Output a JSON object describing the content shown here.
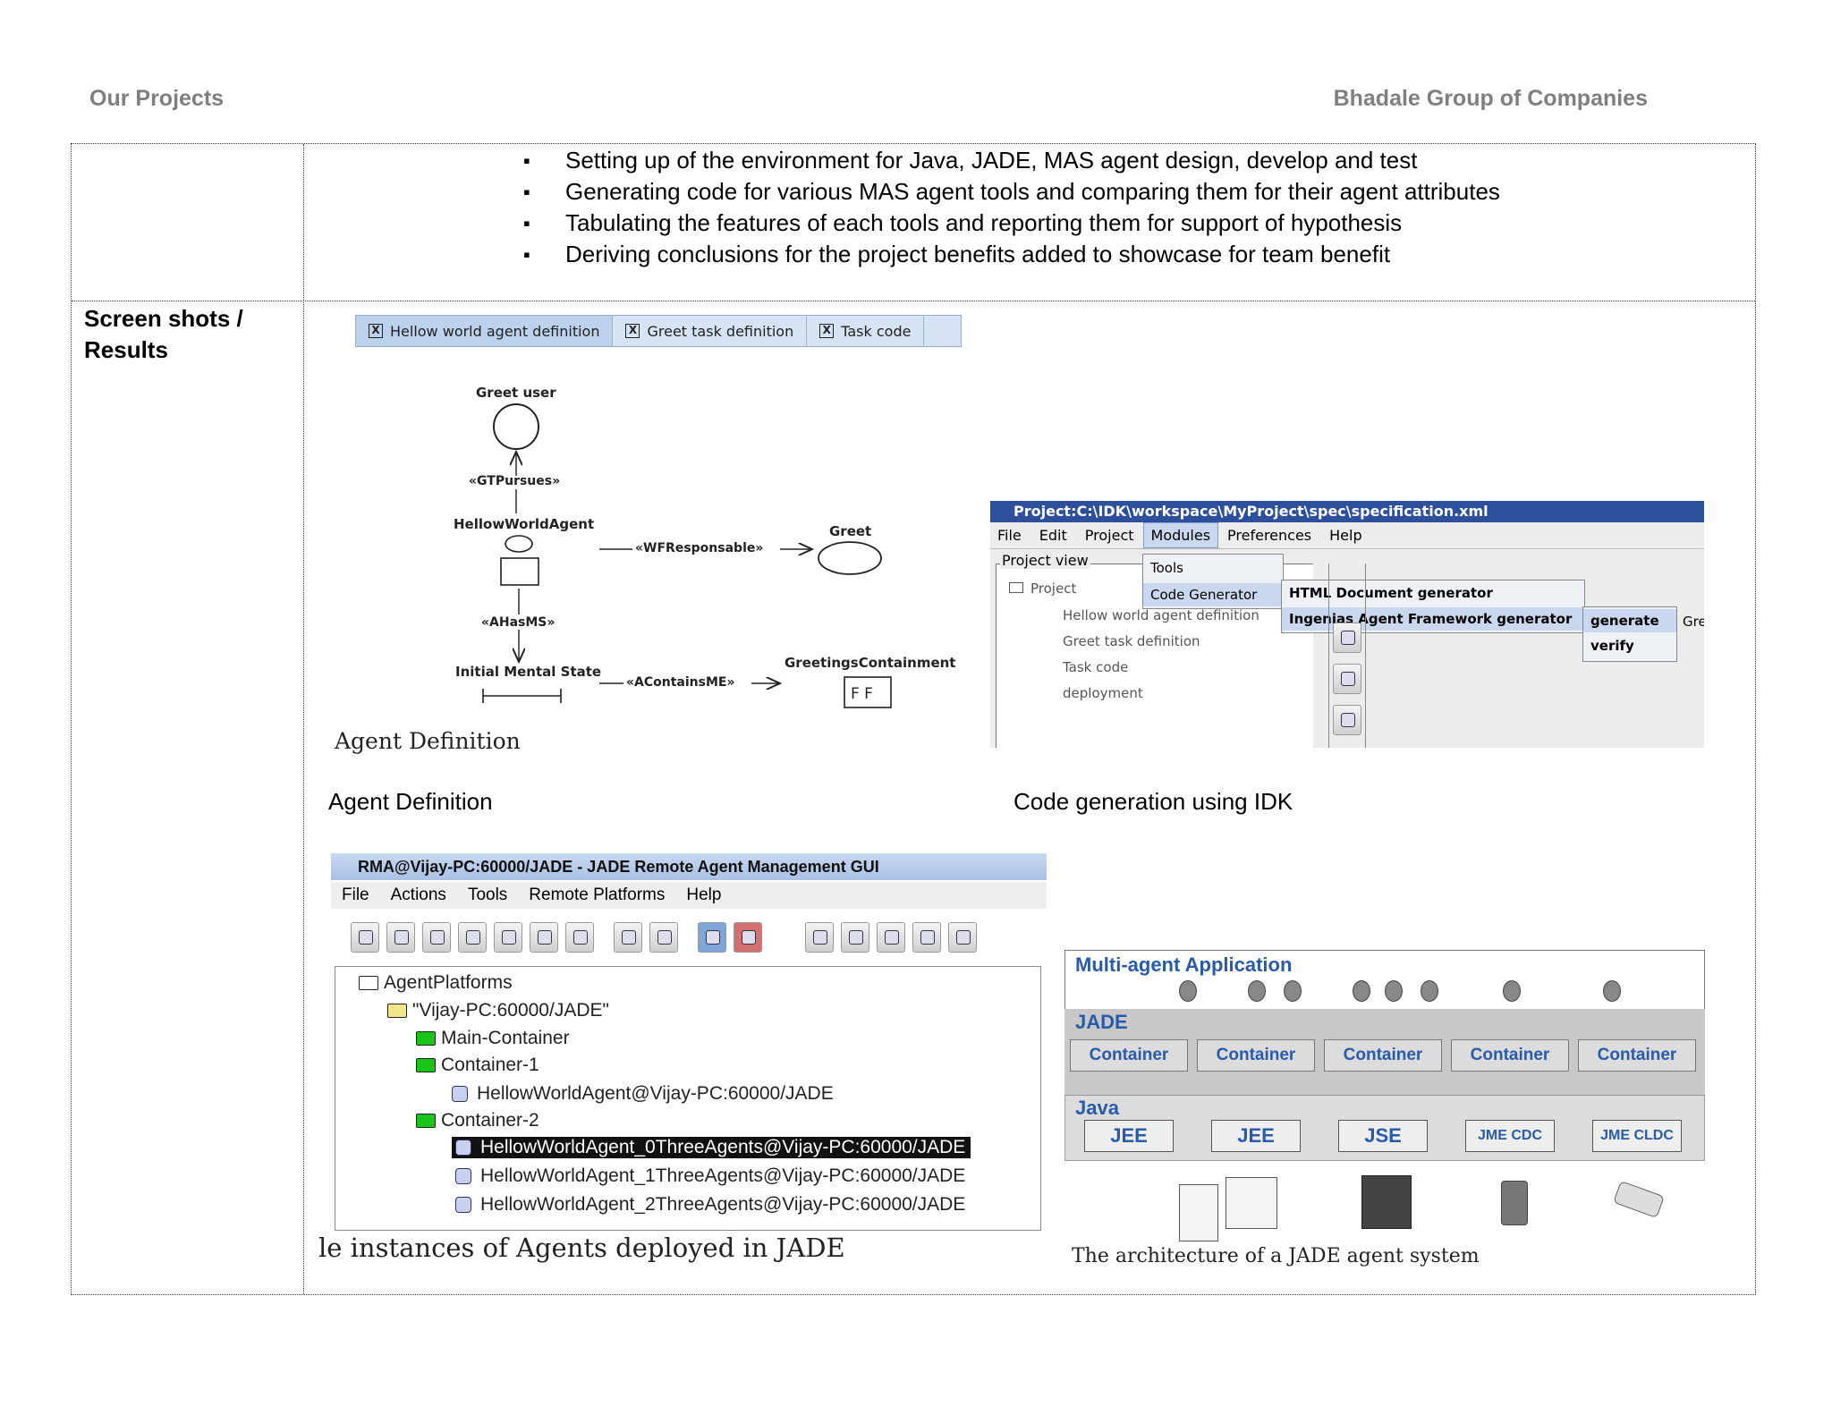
{
  "header": {
    "left": "Our Projects",
    "right": "Bhadale Group of Companies"
  },
  "bullets": [
    "Setting up of the environment for Java, JADE, MAS agent design, develop and test",
    "Generating code for various MAS agent tools and comparing them for their agent attributes",
    "Tabulating the features of each tools and reporting them for support of hypothesis",
    "Deriving conclusions for the project benefits added to showcase for team benefit"
  ],
  "row_label": {
    "line1": "Screen shots /",
    "line2": "Results"
  },
  "agent_definition_shot": {
    "tabs": [
      "Hellow world agent definition",
      "Greet task definition",
      "Task code"
    ],
    "tab_close": "X",
    "labels": {
      "greet_user": "Greet user",
      "gt_pursues": "«GTPursues»",
      "hellow_world_agent": "HellowWorldAgent",
      "wf_responsable": "«WFResponsable»",
      "greet": "Greet",
      "a_has_ms": "«AHasMS»",
      "initial_mental_state": "Initial Mental State",
      "a_contains_me": "«AContainsME»",
      "greetings_containment": "GreetingsContainment",
      "ff": "F F"
    },
    "inner_caption": "Agent Definition"
  },
  "caption_left": "Agent Definition",
  "idk_shot": {
    "title": "Project:C:\\IDK\\workspace\\MyProject\\spec\\specification.xml",
    "menu": [
      "File",
      "Edit",
      "Project",
      "Modules",
      "Preferences",
      "Help"
    ],
    "project_view": "Project view",
    "tree": [
      "Project",
      "Hellow world agent definition",
      "Greet task definition",
      "Task code",
      "deployment"
    ],
    "modules_menu": [
      "Tools",
      "Code Generator"
    ],
    "generator_menu": [
      "HTML Document generator",
      "Ingenias Agent Framework generator"
    ],
    "action_menu": [
      "generate",
      "verify"
    ],
    "cut_text": "Gre"
  },
  "caption_right": "Code generation using IDK",
  "jade_shot": {
    "title": "RMA@Vijay-PC:60000/JADE - JADE Remote Agent Management GUI",
    "menu": [
      "File",
      "Actions",
      "Tools",
      "Remote Platforms",
      "Help"
    ],
    "tree": [
      "AgentPlatforms",
      "\"Vijay-PC:60000/JADE\"",
      "Main-Container",
      "Container-1",
      "HellowWorldAgent@Vijay-PC:60000/JADE",
      "Container-2",
      "HellowWorldAgent_0ThreeAgents@Vijay-PC:60000/JADE",
      "HellowWorldAgent_1ThreeAgents@Vijay-PC:60000/JADE",
      "HellowWorldAgent_2ThreeAgents@Vijay-PC:60000/JADE"
    ],
    "inner_caption": "le instances of Agents deployed in JADE"
  },
  "arch_shot": {
    "app_label": "Multi-agent Application",
    "jade_label": "JADE",
    "containers": [
      "Container",
      "Container",
      "Container",
      "Container",
      "Container"
    ],
    "java_label": "Java",
    "platforms": [
      "JEE",
      "JEE",
      "JSE",
      "JME CDC",
      "JME CLDC"
    ],
    "caption": "The architecture of a JADE agent system"
  },
  "colors": {
    "header_grey": "#7f7f7f",
    "title_bar_blue": "#2e4f9c",
    "jade_blue": "#2a5aa8",
    "menu_highlight": "#c9d8ee"
  }
}
